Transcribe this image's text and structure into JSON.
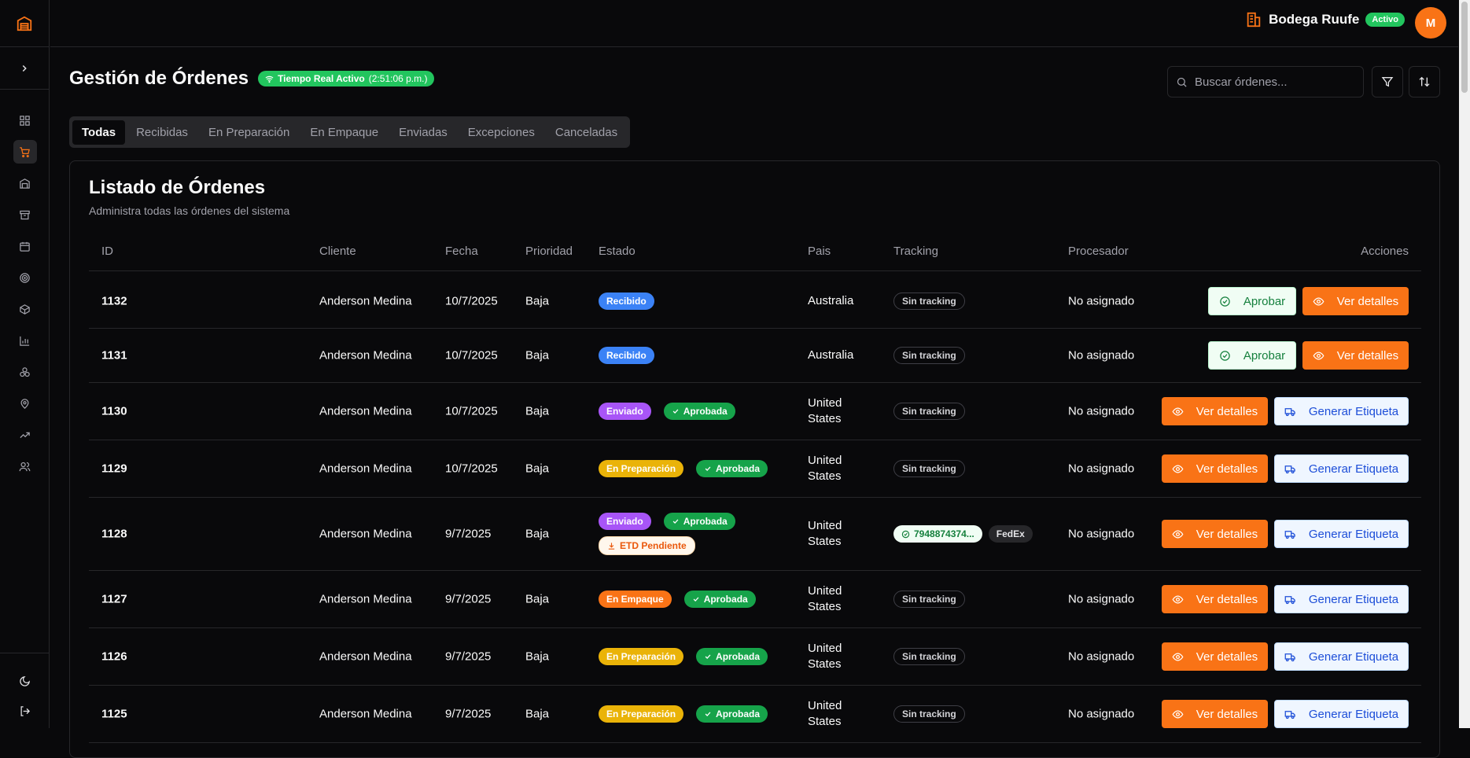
{
  "header": {
    "store_name": "Bodega Ruufe",
    "store_status": "Activo",
    "avatar_initial": "M"
  },
  "page": {
    "title": "Gestión de Órdenes",
    "realtime_label": "Tiempo Real Activo",
    "realtime_time": "(2:51:06 p.m.)",
    "search_placeholder": "Buscar órdenes..."
  },
  "tabs": [
    {
      "label": "Todas",
      "active": true
    },
    {
      "label": "Recibidas"
    },
    {
      "label": "En Preparación"
    },
    {
      "label": "En Empaque"
    },
    {
      "label": "Enviadas"
    },
    {
      "label": "Excepciones"
    },
    {
      "label": "Canceladas"
    }
  ],
  "card": {
    "title": "Listado de Órdenes",
    "subtitle": "Administra todas las órdenes del sistema"
  },
  "columns": {
    "id": "ID",
    "client": "Cliente",
    "date": "Fecha",
    "priority": "Prioridad",
    "status": "Estado",
    "country": "Pais",
    "tracking": "Tracking",
    "processor": "Procesador",
    "actions": "Acciones"
  },
  "labels": {
    "approve": "Aprobar",
    "view": "Ver detalles",
    "generate": "Generar Etiqueta",
    "no_tracking": "Sin tracking",
    "unassigned": "No asignado"
  },
  "rows": [
    {
      "id": "1132",
      "client": "Anderson Medina",
      "date": "10/7/2025",
      "priority": "Baja",
      "status": "Recibido",
      "approved": "",
      "etd": "",
      "country": "Australia",
      "country2": "",
      "tracking": "Sin tracking",
      "carrier": "",
      "processor": "No asignado"
    },
    {
      "id": "1131",
      "client": "Anderson Medina",
      "date": "10/7/2025",
      "priority": "Baja",
      "status": "Recibido",
      "approved": "",
      "etd": "",
      "country": "Australia",
      "country2": "",
      "tracking": "Sin tracking",
      "carrier": "",
      "processor": "No asignado"
    },
    {
      "id": "1130",
      "client": "Anderson Medina",
      "date": "10/7/2025",
      "priority": "Baja",
      "status": "Enviado",
      "approved": "Aprobada",
      "etd": "",
      "country": "United",
      "country2": "States",
      "tracking": "Sin tracking",
      "carrier": "",
      "processor": "No asignado"
    },
    {
      "id": "1129",
      "client": "Anderson Medina",
      "date": "10/7/2025",
      "priority": "Baja",
      "status": "En Preparación",
      "approved": "Aprobada",
      "etd": "",
      "country": "United",
      "country2": "States",
      "tracking": "Sin tracking",
      "carrier": "",
      "processor": "No asignado"
    },
    {
      "id": "1128",
      "client": "Anderson Medina",
      "date": "9/7/2025",
      "priority": "Baja",
      "status": "Enviado",
      "approved": "Aprobada",
      "etd": "ETD Pendiente",
      "country": "United",
      "country2": "States",
      "tracking": "7948874374...",
      "carrier": "FedEx",
      "processor": "No asignado"
    },
    {
      "id": "1127",
      "client": "Anderson Medina",
      "date": "9/7/2025",
      "priority": "Baja",
      "status": "En Empaque",
      "approved": "Aprobada",
      "etd": "",
      "country": "United",
      "country2": "States",
      "tracking": "Sin tracking",
      "carrier": "",
      "processor": "No asignado"
    },
    {
      "id": "1126",
      "client": "Anderson Medina",
      "date": "9/7/2025",
      "priority": "Baja",
      "status": "En Preparación",
      "approved": "Aprobada",
      "etd": "",
      "country": "United",
      "country2": "States",
      "tracking": "Sin tracking",
      "carrier": "",
      "processor": "No asignado"
    },
    {
      "id": "1125",
      "client": "Anderson Medina",
      "date": "9/7/2025",
      "priority": "Baja",
      "status": "En Preparación",
      "approved": "Aprobada",
      "etd": "",
      "country": "United",
      "country2": "States",
      "tracking": "Sin tracking",
      "carrier": "",
      "processor": "No asignado"
    }
  ],
  "colors": {
    "accent": "#f97316",
    "success": "#22c55e",
    "background": "#09090b",
    "border": "#27272a"
  }
}
